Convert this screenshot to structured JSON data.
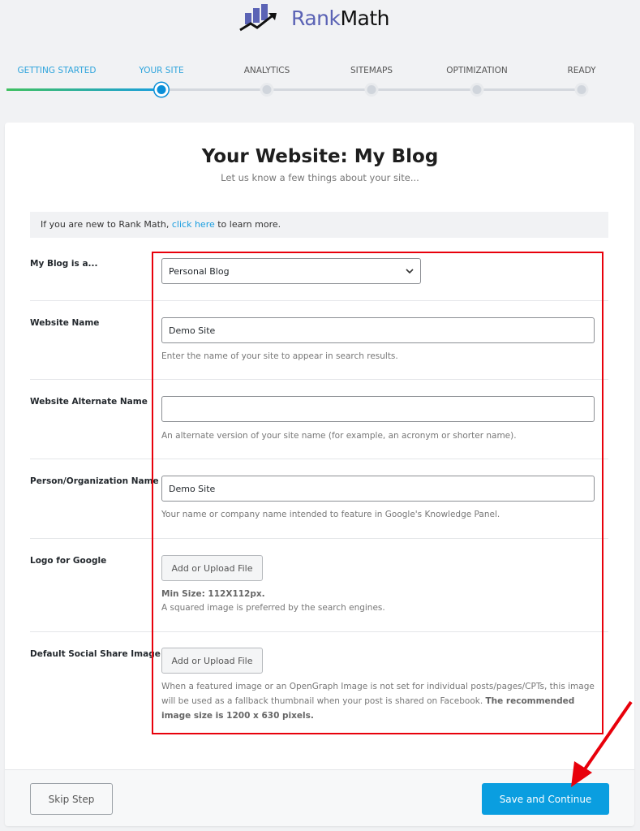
{
  "logo": {
    "part1": "Rank",
    "part2": "Math"
  },
  "steps": [
    {
      "label": "GETTING STARTED",
      "state": "done"
    },
    {
      "label": "YOUR SITE",
      "state": "active"
    },
    {
      "label": "ANALYTICS",
      "state": "pending"
    },
    {
      "label": "SITEMAPS",
      "state": "pending"
    },
    {
      "label": "OPTIMIZATION",
      "state": "pending"
    },
    {
      "label": "READY",
      "state": "pending"
    }
  ],
  "header": {
    "title": "Your Website: My Blog",
    "subtitle": "Let us know a few things about your site..."
  },
  "notice": {
    "before": "If you are new to Rank Math, ",
    "link": "click here",
    "after": " to learn more."
  },
  "fields": {
    "blog_type": {
      "label": "My Blog is a...",
      "value": "Personal Blog"
    },
    "website_name": {
      "label": "Website Name",
      "value": "Demo Site",
      "help": "Enter the name of your site to appear in search results."
    },
    "alt_name": {
      "label": "Website Alternate Name",
      "value": "",
      "help": "An alternate version of your site name (for example, an acronym or shorter name)."
    },
    "org_name": {
      "label": "Person/Organization Name",
      "value": "Demo Site",
      "help": "Your name or company name intended to feature in Google's Knowledge Panel."
    },
    "logo": {
      "label": "Logo for Google",
      "button": "Add or Upload File",
      "min_size": "Min Size: 112X112px.",
      "help": "A squared image is preferred by the search engines."
    },
    "social": {
      "label": "Default Social Share Image",
      "button": "Add or Upload File",
      "help": "When a featured image or an OpenGraph Image is not set for individual posts/pages/CPTs, this image will be used as a fallback thumbnail when your post is shared on Facebook. ",
      "help_bold": "The recommended image size is 1200 x 630 pixels."
    }
  },
  "footer": {
    "skip": "Skip Step",
    "save": "Save and Continue"
  },
  "colors": {
    "accent": "#0a9ee0",
    "highlight": "#e8000b",
    "brand": "#5b63b5"
  }
}
